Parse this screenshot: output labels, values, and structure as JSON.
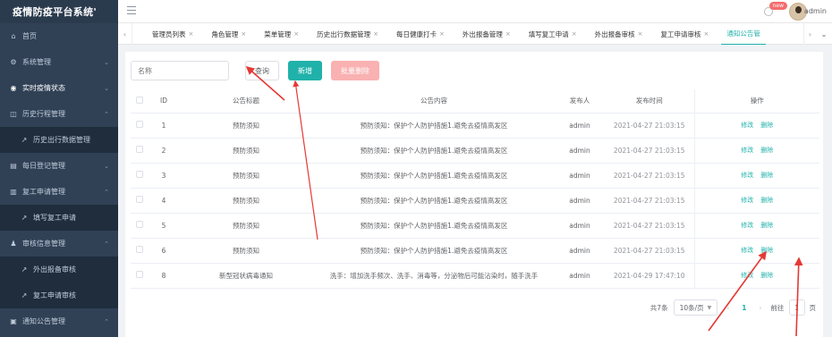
{
  "app": {
    "title": "疫情防疫平台系统'"
  },
  "header": {
    "badge": "new",
    "user": "admin"
  },
  "sidebar": {
    "items": [
      {
        "icon": "home-icon",
        "glyph": "⌂",
        "label": "首页",
        "arrow": ""
      },
      {
        "icon": "gear-icon",
        "glyph": "⚙",
        "label": "系统管理",
        "arrow": "⌄"
      },
      {
        "icon": "location-icon",
        "glyph": "◉",
        "label": "实时疫情状态",
        "arrow": "⌄",
        "active": true
      },
      {
        "icon": "history-icon",
        "glyph": "◫",
        "label": "历史行程管理",
        "arrow": "⌃"
      },
      {
        "icon": "send-icon",
        "glyph": "↗",
        "label": "历史出行数据管理",
        "sub": true
      },
      {
        "icon": "calendar-icon",
        "glyph": "▤",
        "label": "每日登记管理",
        "arrow": "⌄"
      },
      {
        "icon": "chart-icon",
        "glyph": "▥",
        "label": "复工申请管理",
        "arrow": "⌃"
      },
      {
        "icon": "send-icon",
        "glyph": "↗",
        "label": "填写复工申请",
        "sub": true
      },
      {
        "icon": "person-icon",
        "glyph": "♟",
        "label": "审核信息管理",
        "arrow": "⌃"
      },
      {
        "icon": "send-icon",
        "glyph": "↗",
        "label": "外出报备审核",
        "sub": true
      },
      {
        "icon": "send-icon",
        "glyph": "↗",
        "label": "复工申请审核",
        "sub": true
      },
      {
        "icon": "notice-icon",
        "glyph": "▣",
        "label": "通知公告管理",
        "arrow": "⌃"
      }
    ]
  },
  "tabs": [
    {
      "label": "管理员列表"
    },
    {
      "label": "角色管理"
    },
    {
      "label": "菜单管理"
    },
    {
      "label": "历史出行数据管理"
    },
    {
      "label": "每日健康打卡"
    },
    {
      "label": "外出报备管理"
    },
    {
      "label": "填写复工申请"
    },
    {
      "label": "外出报备审核"
    },
    {
      "label": "复工申请审核"
    },
    {
      "label": "通知公告管",
      "active": true
    }
  ],
  "toolbar": {
    "search_placeholder": "名称",
    "search_label": "查询",
    "add_label": "新增",
    "batch_delete_label": "批量删除"
  },
  "table": {
    "headers": [
      "ID",
      "公告标题",
      "公告内容",
      "发布人",
      "发布时间",
      "操作"
    ],
    "rows": [
      {
        "id": "1",
        "title": "预防须知",
        "content": "预防须知：保护个人防护措施1.避免去疫情高发区",
        "publisher": "admin",
        "time": "2021-04-27 21:03:15"
      },
      {
        "id": "2",
        "title": "预防须知",
        "content": "预防须知：保护个人防护措施1.避免去疫情高发区",
        "publisher": "admin",
        "time": "2021-04-27 21:03:15"
      },
      {
        "id": "3",
        "title": "预防须知",
        "content": "预防须知：保护个人防护措施1.避免去疫情高发区",
        "publisher": "admin",
        "time": "2021-04-27 21:03:15"
      },
      {
        "id": "4",
        "title": "预防须知",
        "content": "预防须知：保护个人防护措施1.避免去疫情高发区",
        "publisher": "admin",
        "time": "2021-04-27 21:03:15"
      },
      {
        "id": "5",
        "title": "预防须知",
        "content": "预防须知：保护个人防护措施1.避免去疫情高发区",
        "publisher": "admin",
        "time": "2021-04-27 21:03:15"
      },
      {
        "id": "6",
        "title": "预防须知",
        "content": "预防须知：保护个人防护措施1.避免去疫情高发区",
        "publisher": "admin",
        "time": "2021-04-27 21:03:15"
      },
      {
        "id": "8",
        "title": "新型冠状病毒通知",
        "content": "洗手：增加洗手频次、洗手、消毒等，分泌物后可能沾染时，随手洗手",
        "publisher": "admin",
        "time": "2021-04-29 17:47:10"
      }
    ],
    "edit_label": "修改",
    "delete_label": "删除"
  },
  "pagination": {
    "total_text": "共7条",
    "page_size": "10条/页",
    "current_page": "1",
    "goto_label": "前往",
    "goto_value": "1",
    "page_suffix": "页"
  },
  "colors": {
    "sidebar": "#304156",
    "accent": "#20b2aa",
    "danger_light": "#f9b1b1",
    "annotation": "#e53935"
  }
}
